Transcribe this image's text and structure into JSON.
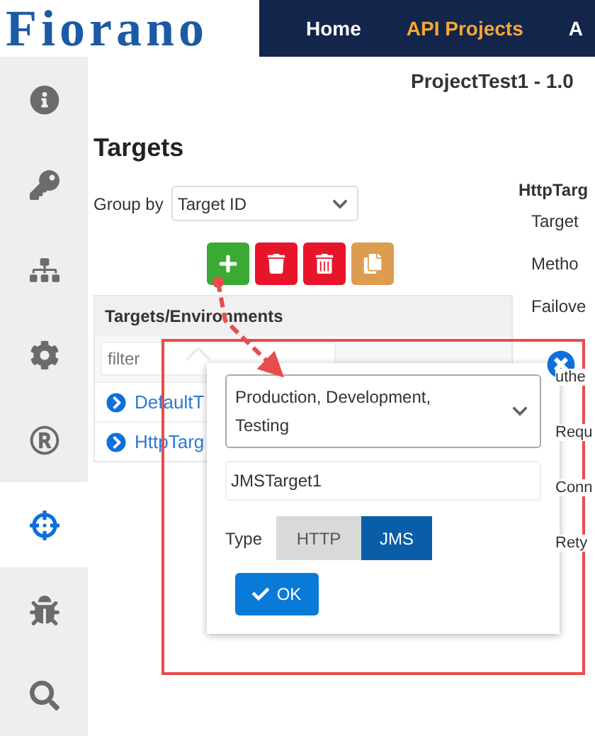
{
  "logo": "Fiorano",
  "nav": [
    {
      "label": "Home",
      "selected": false
    },
    {
      "label": "API Projects",
      "selected": true
    },
    {
      "label": "A",
      "selected": false
    }
  ],
  "sidebar": [
    {
      "kind": "info",
      "selected": false
    },
    {
      "kind": "key",
      "selected": false
    },
    {
      "kind": "flow",
      "selected": false
    },
    {
      "kind": "settings",
      "selected": false
    },
    {
      "kind": "registered",
      "selected": false
    },
    {
      "kind": "target",
      "selected": true
    },
    {
      "kind": "bug",
      "selected": false
    },
    {
      "kind": "search",
      "selected": false
    }
  ],
  "project_title": "ProjectTest1 - 1.0",
  "section_title": "Targets",
  "group_by": {
    "label": "Group by",
    "value": "Target ID"
  },
  "toolbar": [
    {
      "kind": "add"
    },
    {
      "kind": "delete"
    },
    {
      "kind": "delete-all"
    },
    {
      "kind": "copy"
    }
  ],
  "tree": {
    "header": "Targets/Environments",
    "filter_placeholder": "filter",
    "rows": [
      {
        "label": "DefaultT"
      },
      {
        "label": "HttpTarg"
      }
    ]
  },
  "details": {
    "title": "HttpTarg",
    "labels": [
      {
        "label": "Target",
        "kind": "plain"
      },
      {
        "label": "Metho",
        "kind": "plain"
      },
      {
        "label": "Failove",
        "kind": "plain"
      },
      {
        "label": "uthe",
        "kind": "panel"
      },
      {
        "label": "Requ",
        "kind": "covered"
      },
      {
        "label": "Conn",
        "kind": "covered"
      },
      {
        "label": "Rety",
        "kind": "covered"
      }
    ]
  },
  "popup": {
    "environments": "Production, Development, Testing",
    "name": "JMSTarget1",
    "type_label": "Type",
    "types": [
      {
        "label": "HTTP",
        "selected": false
      },
      {
        "label": "JMS",
        "selected": true
      }
    ],
    "ok": "OK"
  }
}
